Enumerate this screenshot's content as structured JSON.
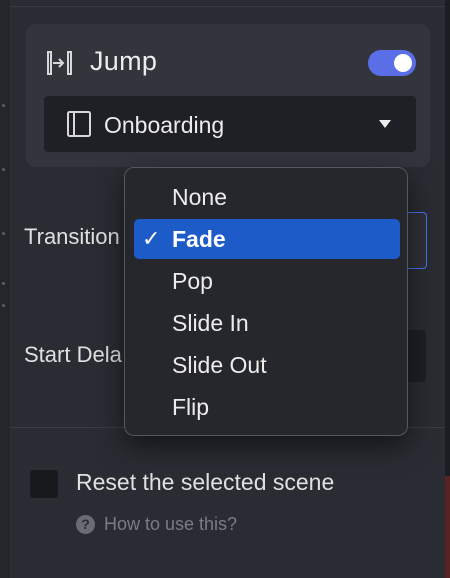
{
  "action": {
    "title": "Jump",
    "icon": "jump-icon",
    "enabled": true,
    "scene": {
      "label": "Onboarding",
      "icon": "scene-frame-icon"
    }
  },
  "transition": {
    "label": "Transition",
    "selected": "Fade",
    "options": [
      "None",
      "Fade",
      "Pop",
      "Slide In",
      "Slide Out",
      "Flip"
    ],
    "check_glyph": "✓"
  },
  "start_delay": {
    "label": "Start Dela"
  },
  "reset": {
    "label": "Reset the selected scene",
    "checked": false
  },
  "help": {
    "glyph": "?",
    "label": "How to use this?"
  },
  "colors": {
    "accent": "#5a6ee8",
    "selection": "#1d5bc9",
    "background": "#2a2c33",
    "card": "#33353d"
  }
}
